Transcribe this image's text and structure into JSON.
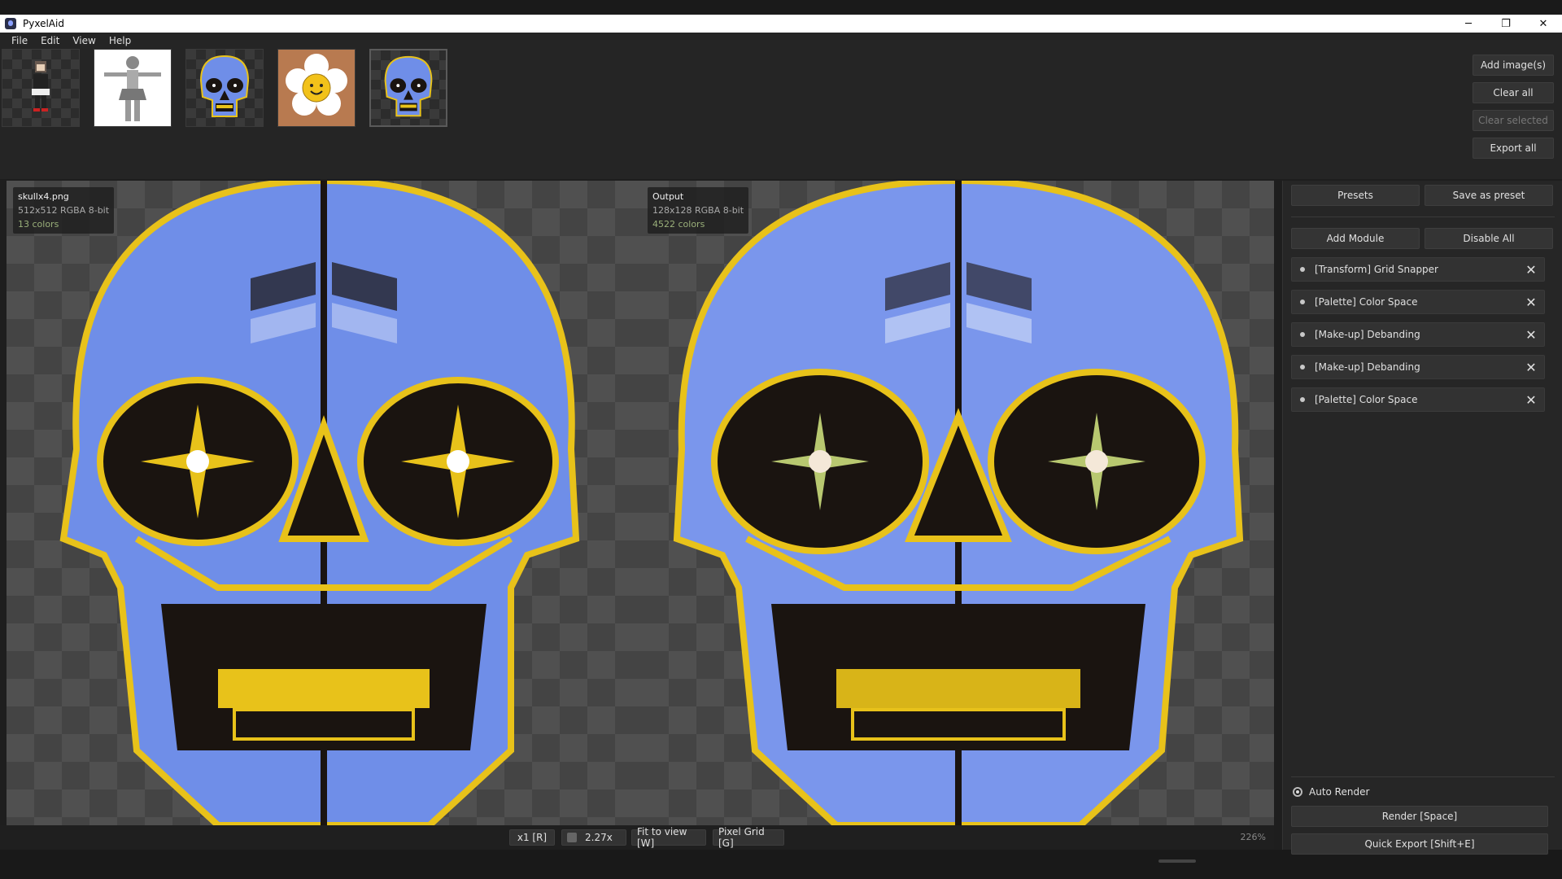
{
  "window": {
    "title": "PyxelAid",
    "minimize": "─",
    "restore": "❐",
    "close": "✕"
  },
  "menu": [
    "File",
    "Edit",
    "View",
    "Help"
  ],
  "thumbnails": [
    {
      "name": "character"
    },
    {
      "name": "girl-tpose"
    },
    {
      "name": "skull"
    },
    {
      "name": "flower"
    },
    {
      "name": "skull-selected"
    }
  ],
  "side_buttons": {
    "add_images": "Add image(s)",
    "clear_all": "Clear all",
    "clear_selected": "Clear selected",
    "export_all": "Export all"
  },
  "input": {
    "filename": "skullx4.png",
    "meta": "512x512  RGBA  8-bit",
    "colors": "13 colors"
  },
  "output": {
    "label": "Output",
    "meta": "128x128  RGBA  8-bit",
    "colors": "4522 colors"
  },
  "bottom": {
    "x1": "x1 [R]",
    "zoom_value": "2.27x",
    "fit": "Fit to view [W]",
    "grid": "Pixel Grid [G]",
    "zoom_percent": "226%"
  },
  "panel": {
    "presets": "Presets",
    "save_preset": "Save as preset",
    "add_module": "Add Module",
    "disable_all": "Disable All",
    "modules": [
      "[Transform] Grid Snapper",
      "[Palette] Color Space",
      "[Make-up] Debanding",
      "[Make-up] Debanding",
      "[Palette] Color Space"
    ],
    "auto_render": "Auto Render",
    "render": "Render  [Space]",
    "quick_export": "Quick Export  [Shift+E]"
  },
  "colors": {
    "skull_blue": "#6f8ee8",
    "gold": "#e8c21a",
    "dark": "#1a1410"
  }
}
